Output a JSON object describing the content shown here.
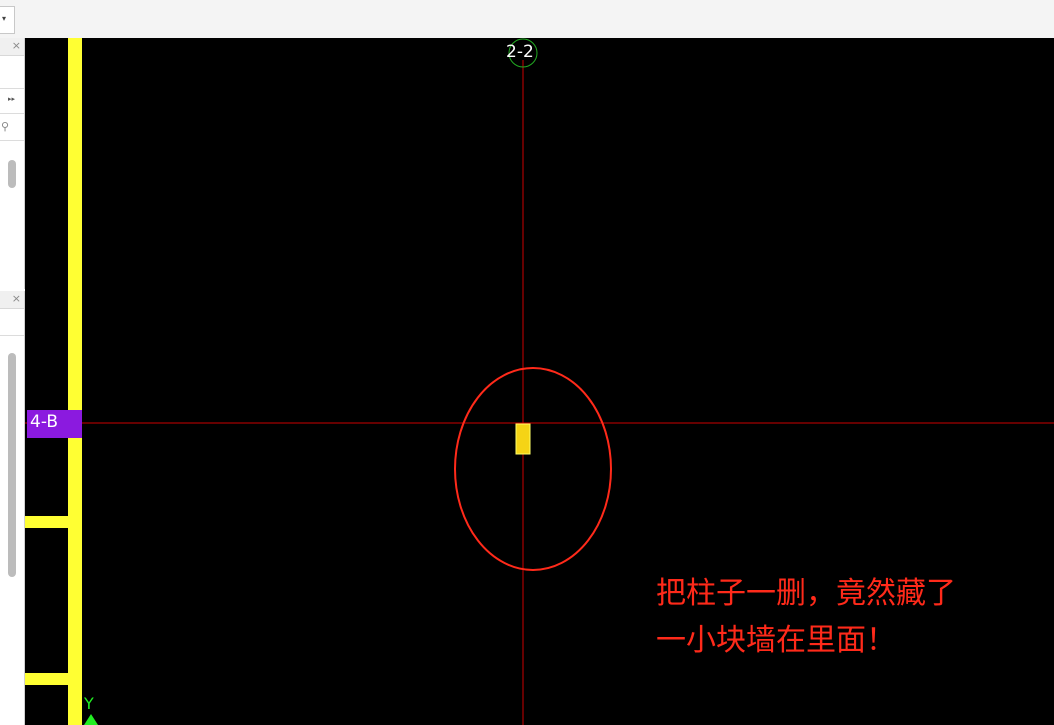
{
  "dropdown": {
    "icon": "chevron-down-icon",
    "glyph": "▾"
  },
  "panel_top": {
    "close_glyph": "×",
    "expand_glyph": "▸▸",
    "search_icon": "search-icon",
    "search_glyph": "⚲"
  },
  "panel_bottom": {
    "close_glyph": "×"
  },
  "canvas": {
    "axis_top_label": "2-2",
    "axis_left_label": "4-B",
    "y_axis_label": "Y",
    "annotation_line1": "把柱子一删，竟然藏了",
    "annotation_line2": "一小块墙在里面！",
    "colors": {
      "background": "#000000",
      "wall": "#ffff33",
      "grid_line": "#cc0000",
      "highlight_circle": "#ff2a1a",
      "axis_tag": "#8b1adf"
    }
  }
}
